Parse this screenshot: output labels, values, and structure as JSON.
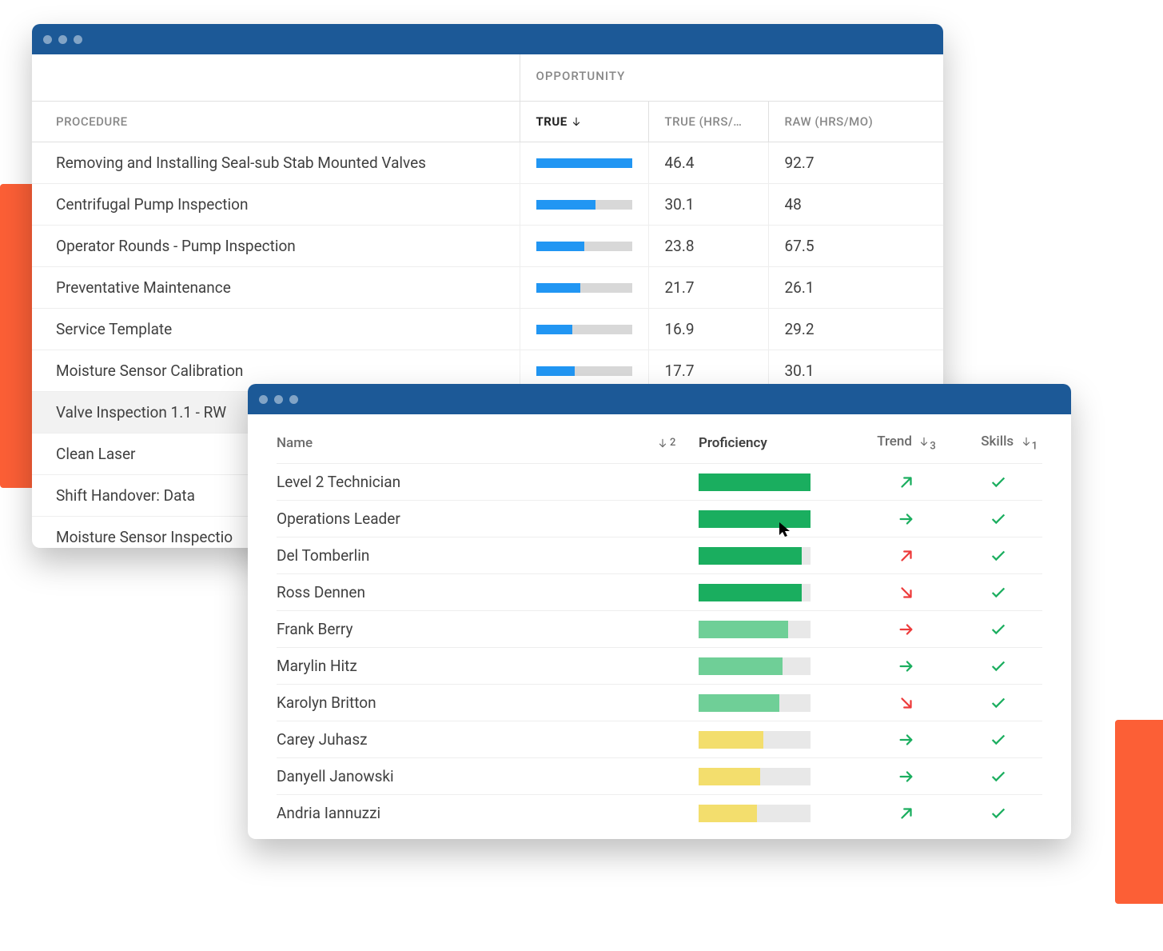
{
  "back": {
    "opportunity_label": "OPPORTUNITY",
    "headers": {
      "procedure": "PROCEDURE",
      "true": "TRUE",
      "true_hrs": "TRUE (HRS/…",
      "raw_hrs": "RAW (HRS/MO)"
    },
    "rows": [
      {
        "name": "Removing and Installing Seal-sub Stab Mounted Valves",
        "bar": 100,
        "true_hrs": "46.4",
        "raw_hrs": "92.7"
      },
      {
        "name": "Centrifugal Pump Inspection",
        "bar": 62,
        "true_hrs": "30.1",
        "raw_hrs": "48"
      },
      {
        "name": "Operator Rounds - Pump Inspection",
        "bar": 50,
        "true_hrs": "23.8",
        "raw_hrs": "67.5"
      },
      {
        "name": "Preventative Maintenance",
        "bar": 46,
        "true_hrs": "21.7",
        "raw_hrs": "26.1"
      },
      {
        "name": "Service Template",
        "bar": 38,
        "true_hrs": "16.9",
        "raw_hrs": "29.2"
      },
      {
        "name": "Moisture Sensor Calibration",
        "bar": 40,
        "true_hrs": "17.7",
        "raw_hrs": "30.1"
      },
      {
        "name": "Valve Inspection 1.1 - RW",
        "selected": true
      },
      {
        "name": "Clean Laser"
      },
      {
        "name": "Shift Handover: Data"
      },
      {
        "name": "Moisture Sensor Inspectio"
      }
    ]
  },
  "front": {
    "headers": {
      "name": "Name",
      "name_sort": "2",
      "proficiency": "Proficiency",
      "trend": "Trend",
      "trend_sort": "3",
      "skills": "Skills",
      "skills_sort": "1"
    },
    "rows": [
      {
        "name": "Level 2 Technician",
        "bar": 100,
        "level": "darkgreen",
        "trend": "up-right",
        "trend_color": "green"
      },
      {
        "name": "Operations Leader",
        "bar": 100,
        "level": "darkgreen",
        "trend": "right",
        "trend_color": "green",
        "cursor": true
      },
      {
        "name": "Del Tomberlin",
        "bar": 92,
        "level": "darkgreen",
        "trend": "up-right",
        "trend_color": "red"
      },
      {
        "name": "Ross Dennen",
        "bar": 92,
        "level": "darkgreen",
        "trend": "down-right",
        "trend_color": "red"
      },
      {
        "name": "Frank Berry",
        "bar": 80,
        "level": "green",
        "trend": "right",
        "trend_color": "red"
      },
      {
        "name": "Marylin Hitz",
        "bar": 75,
        "level": "green",
        "trend": "right",
        "trend_color": "green"
      },
      {
        "name": "Karolyn Britton",
        "bar": 72,
        "level": "green",
        "trend": "down-right",
        "trend_color": "red"
      },
      {
        "name": "Carey Juhasz",
        "bar": 58,
        "level": "yellow",
        "trend": "right",
        "trend_color": "green"
      },
      {
        "name": "Danyell Janowski",
        "bar": 55,
        "level": "yellow",
        "trend": "right",
        "trend_color": "green"
      },
      {
        "name": "Andria Iannuzzi",
        "bar": 52,
        "level": "yellow",
        "trend": "up-right",
        "trend_color": "green"
      }
    ]
  }
}
